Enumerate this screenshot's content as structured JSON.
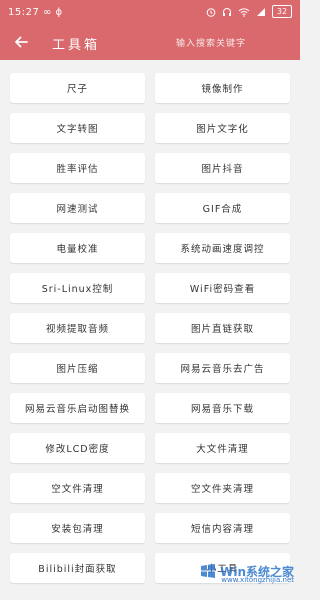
{
  "status": {
    "time": "15:27",
    "left_icons": "∞ ϕ",
    "battery": "32"
  },
  "toolbar": {
    "title": "工具箱",
    "search_placeholder": "输入搜索关键字"
  },
  "tools": [
    "尺子",
    "镜像制作",
    "文字转图",
    "图片文字化",
    "胜率评估",
    "图片抖音",
    "网速测试",
    "GIF合成",
    "电量校准",
    "系统动画速度调控",
    "Sri-Linux控制",
    "WiFi密码查看",
    "视频提取音频",
    "图片直链获取",
    "图片压缩",
    "网易云音乐去广告",
    "网易云音乐启动图替换",
    "网易音乐下载",
    "修改LCD密度",
    "大文件清理",
    "空文件清理",
    "空文件夹清理",
    "安装包清理",
    "短信内容清理",
    "Bilibili封面获取",
    "小工具"
  ],
  "watermark": {
    "brand": "Win系统之家",
    "domain": "www.xitongzhijia.net"
  },
  "colors": {
    "header": "#d9696c",
    "background": "#f2f2f2",
    "tile": "#ffffff"
  }
}
